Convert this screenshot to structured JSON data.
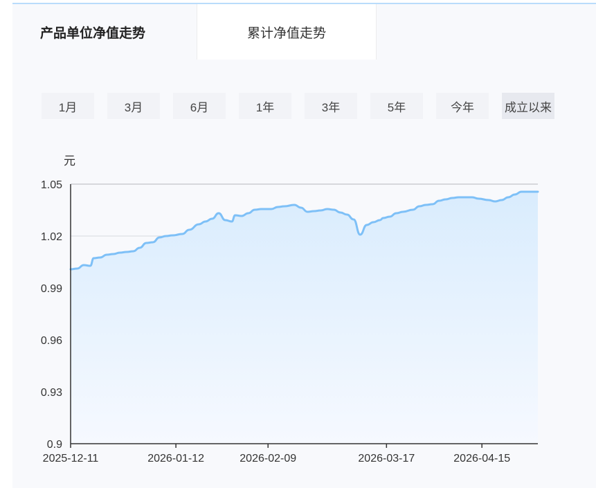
{
  "tabs": [
    {
      "label": "产品单位净值走势",
      "active": true
    },
    {
      "label": "累计净值走势",
      "active": false
    }
  ],
  "ranges": [
    "1月",
    "3月",
    "6月",
    "1年",
    "3年",
    "5年",
    "今年",
    "成立以来"
  ],
  "active_range": "成立以来",
  "colors": {
    "line": "#7ec0f7",
    "fill_top": "#d9ecfd",
    "fill_bottom": "#f6f9ff",
    "grid": "#d6d9de",
    "axis": "#333333"
  },
  "chart_data": {
    "type": "area",
    "ylabel": "元",
    "ylim": [
      0.9,
      1.05
    ],
    "yticks": [
      "1.05",
      "1.02",
      "0.99",
      "0.96",
      "0.93",
      "0.9"
    ],
    "xticks": [
      "2025-12-11",
      "2026-01-12",
      "2026-02-09",
      "2026-03-17",
      "2026-04-15"
    ],
    "grid": true,
    "series": [
      {
        "x": [
          "2025-12-11",
          "2025-12-13",
          "2025-12-15",
          "2025-12-17",
          "2025-12-18",
          "2025-12-20",
          "2025-12-22",
          "2025-12-24",
          "2025-12-26",
          "2025-12-28",
          "2025-12-30",
          "2026-01-01",
          "2026-01-03",
          "2026-01-05",
          "2026-01-07",
          "2026-01-09",
          "2026-01-11",
          "2026-01-14",
          "2026-01-16",
          "2026-01-19",
          "2026-01-21",
          "2026-01-23",
          "2026-01-25",
          "2026-01-27",
          "2026-01-29",
          "2026-01-30",
          "2026-02-01",
          "2026-02-03",
          "2026-02-05",
          "2026-02-07",
          "2026-02-10",
          "2026-02-12",
          "2026-02-14",
          "2026-02-17",
          "2026-02-19",
          "2026-02-21",
          "2026-02-23",
          "2026-02-25",
          "2026-02-27",
          "2026-03-01",
          "2026-03-03",
          "2026-03-05",
          "2026-03-07",
          "2026-03-09",
          "2026-03-11",
          "2026-03-13",
          "2026-03-15",
          "2026-03-16",
          "2026-03-18",
          "2026-03-20",
          "2026-03-22",
          "2026-03-25",
          "2026-03-27",
          "2026-03-29",
          "2026-03-31",
          "2026-04-02",
          "2026-04-04",
          "2026-04-06",
          "2026-04-08",
          "2026-04-10",
          "2026-04-12",
          "2026-04-14",
          "2026-04-17",
          "2026-04-19",
          "2026-04-21",
          "2026-04-23",
          "2026-04-25",
          "2026-04-27",
          "2026-04-29",
          "2026-05-01",
          "2026-05-02"
        ],
        "values": [
          1.0008,
          1.0012,
          1.0032,
          1.0028,
          1.0072,
          1.0076,
          1.0092,
          1.0096,
          1.0104,
          1.0108,
          1.0112,
          1.0132,
          1.016,
          1.0164,
          1.0192,
          1.02,
          1.0204,
          1.0212,
          1.0236,
          1.0268,
          1.0284,
          1.03,
          1.0332,
          1.0292,
          1.0284,
          1.032,
          1.0316,
          1.0332,
          1.0352,
          1.0356,
          1.0356,
          1.0368,
          1.0372,
          1.038,
          1.0364,
          1.034,
          1.0344,
          1.0348,
          1.0356,
          1.0352,
          1.0336,
          1.0324,
          1.0296,
          1.0208,
          1.0264,
          1.028,
          1.0292,
          1.0304,
          1.0312,
          1.0332,
          1.034,
          1.0352,
          1.0372,
          1.038,
          1.0384,
          1.0404,
          1.0412,
          1.042,
          1.0424,
          1.0424,
          1.0424,
          1.0416,
          1.0408,
          1.04,
          1.0408,
          1.0424,
          1.044,
          1.0456,
          1.0456,
          1.0456,
          1.0456
        ]
      }
    ]
  }
}
